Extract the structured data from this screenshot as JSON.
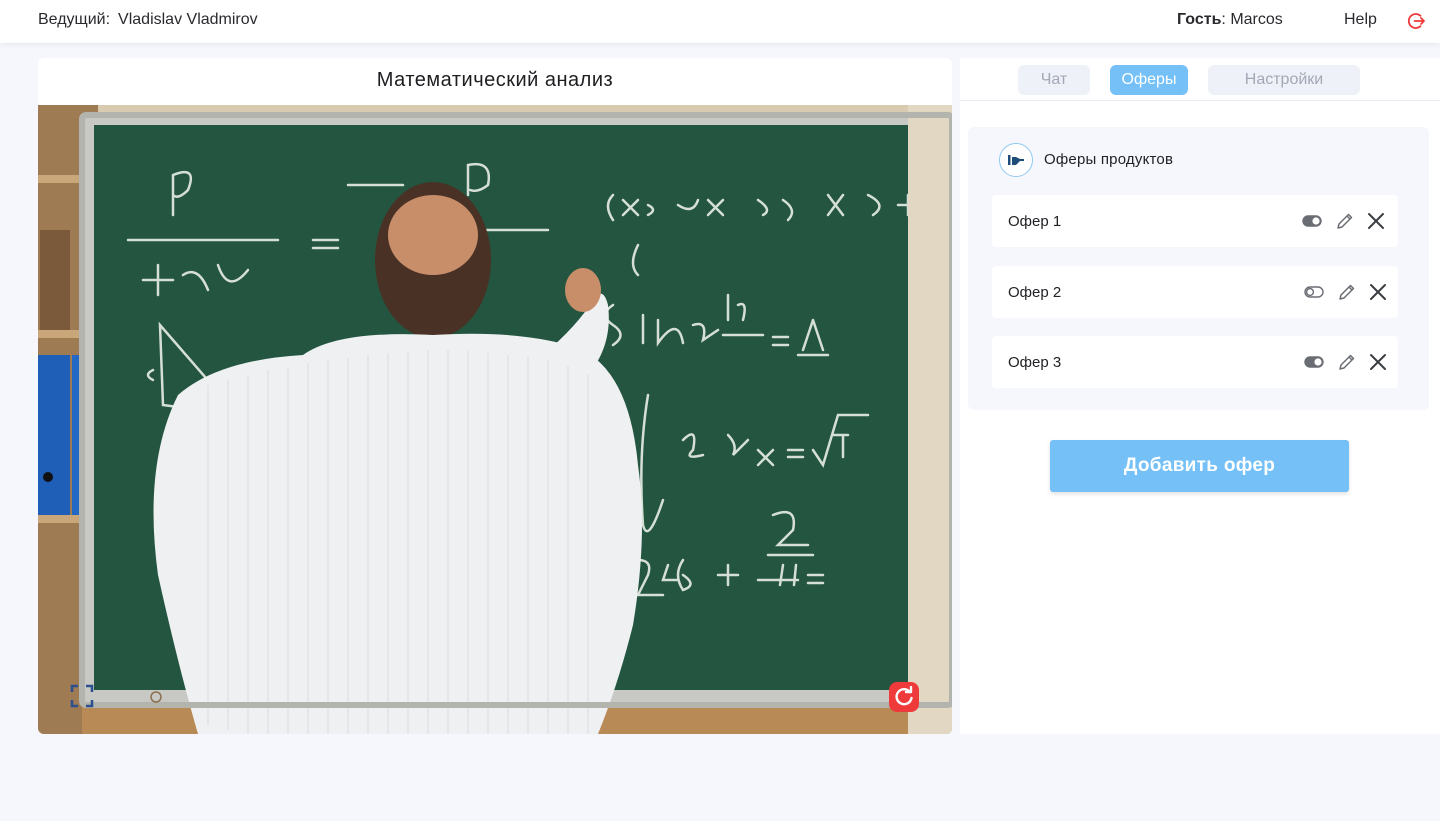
{
  "topbar": {
    "host_label": "Ведущий:",
    "host_name": "Vladislav Vladmirov",
    "guest_label": "Гость",
    "guest_sep": ":",
    "guest_name": "Marcos",
    "help_label": "Help"
  },
  "video": {
    "title": "Математический анализ"
  },
  "tabs": [
    {
      "label": "Чат",
      "active": false
    },
    {
      "label": "Оферы",
      "active": true
    },
    {
      "label": "Настройки",
      "active": false
    }
  ],
  "offers": {
    "section_title": "Оферы продуктов",
    "items": [
      {
        "label": "Офер 1",
        "enabled": true
      },
      {
        "label": "Офер 2",
        "enabled": false
      },
      {
        "label": "Офер 3",
        "enabled": true
      }
    ],
    "add_button_label": "Добавить офер"
  },
  "colors": {
    "accent": "#74c0f7",
    "danger": "#ee3a3a",
    "background": "#f5f7fc"
  },
  "icons": [
    "logout-icon",
    "expand-icon",
    "refresh-icon",
    "offers-icon",
    "toggle-icon",
    "pencil-icon",
    "close-icon"
  ]
}
